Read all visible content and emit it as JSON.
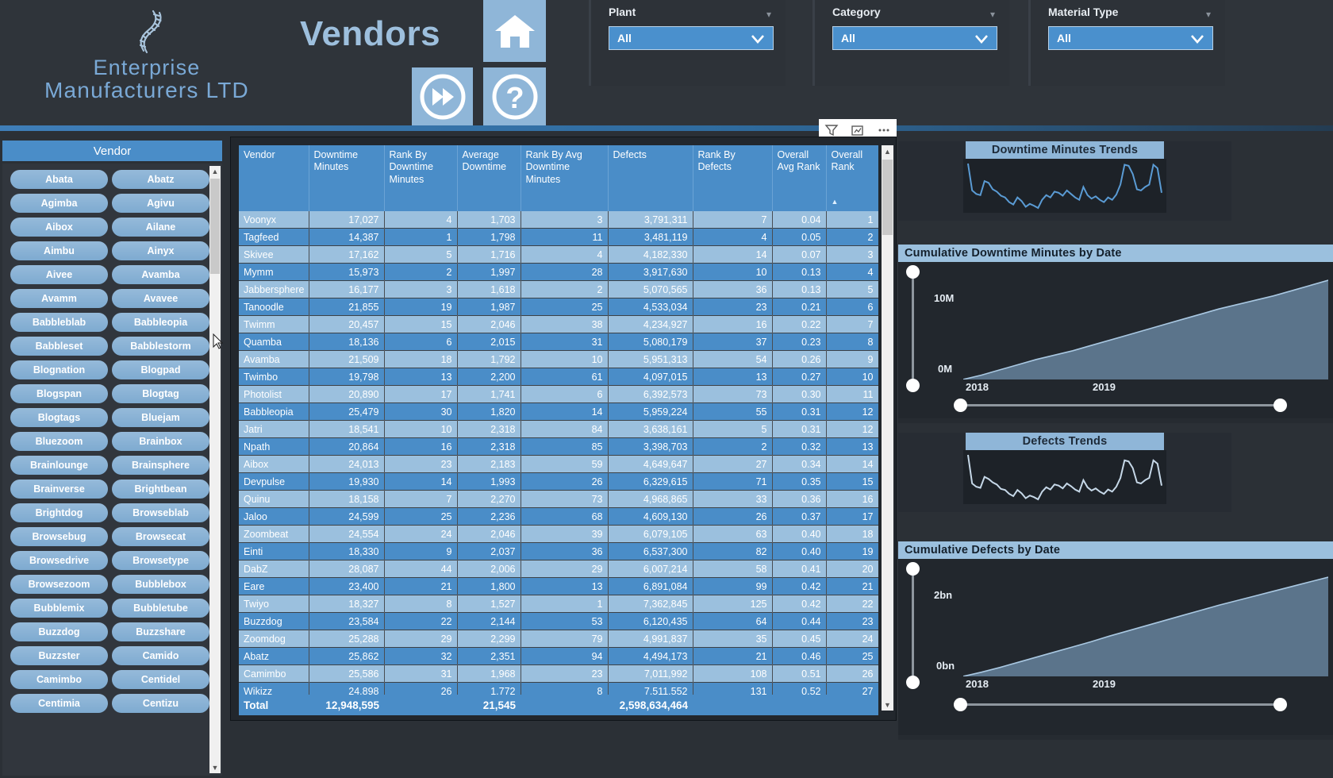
{
  "header": {
    "company_line1": "Enterprise",
    "company_line2": "Manufacturers LTD",
    "page_title": "Vendors",
    "nav": {
      "home": "home-icon",
      "next": "fast-forward-icon",
      "help": "question-mark-icon"
    }
  },
  "slicers": [
    {
      "label": "Plant",
      "value": "All"
    },
    {
      "label": "Category",
      "value": "All"
    },
    {
      "label": "Material Type",
      "value": "All"
    }
  ],
  "vendor_slicer": {
    "title": "Vendor",
    "items": [
      "Abata",
      "Abatz",
      "Agimba",
      "Agivu",
      "Aibox",
      "Ailane",
      "Aimbu",
      "Ainyx",
      "Aivee",
      "Avamba",
      "Avamm",
      "Avavee",
      "Babbleblab",
      "Babbleopia",
      "Babbleset",
      "Babblestorm",
      "Blognation",
      "Blogpad",
      "Blogspan",
      "Blogtag",
      "Blogtags",
      "Bluejam",
      "Bluezoom",
      "Brainbox",
      "Brainlounge",
      "Brainsphere",
      "Brainverse",
      "Brightbean",
      "Brightdog",
      "Browseblab",
      "Browsebug",
      "Browsecat",
      "Browsedrive",
      "Browsetype",
      "Browsezoom",
      "Bubblebox",
      "Bubblemix",
      "Bubbletube",
      "Buzzdog",
      "Buzzshare",
      "Buzzster",
      "Camido",
      "Camimbo",
      "Centidel",
      "Centimia",
      "Centizu"
    ]
  },
  "visual_toolbar": {
    "filter": "filter-icon",
    "focus": "focus-mode-icon",
    "more": "more-options-icon"
  },
  "table": {
    "columns": [
      "Vendor",
      "Downtime Minutes",
      "Rank By Downtime Minutes",
      "Average Downtime",
      "Rank By Avg Downtime Minutes",
      "Defects",
      "Rank By Defects",
      "Overall Avg Rank",
      "Overall Rank"
    ],
    "sorted_column": "Overall Rank",
    "sort_direction": "asc",
    "rows": [
      [
        "Voonyx",
        "17,027",
        "4",
        "1,703",
        "3",
        "3,791,311",
        "7",
        "0.04",
        "1"
      ],
      [
        "Tagfeed",
        "14,387",
        "1",
        "1,798",
        "11",
        "3,481,119",
        "4",
        "0.05",
        "2"
      ],
      [
        "Skivee",
        "17,162",
        "5",
        "1,716",
        "4",
        "4,182,330",
        "14",
        "0.07",
        "3"
      ],
      [
        "Mymm",
        "15,973",
        "2",
        "1,997",
        "28",
        "3,917,630",
        "10",
        "0.13",
        "4"
      ],
      [
        "Jabbersphere",
        "16,177",
        "3",
        "1,618",
        "2",
        "5,070,565",
        "36",
        "0.13",
        "5"
      ],
      [
        "Tanoodle",
        "21,855",
        "19",
        "1,987",
        "25",
        "4,533,034",
        "23",
        "0.21",
        "6"
      ],
      [
        "Twimm",
        "20,457",
        "15",
        "2,046",
        "38",
        "4,234,927",
        "16",
        "0.22",
        "7"
      ],
      [
        "Quamba",
        "18,136",
        "6",
        "2,015",
        "31",
        "5,080,179",
        "37",
        "0.23",
        "8"
      ],
      [
        "Avamba",
        "21,509",
        "18",
        "1,792",
        "10",
        "5,951,313",
        "54",
        "0.26",
        "9"
      ],
      [
        "Twimbo",
        "19,798",
        "13",
        "2,200",
        "61",
        "4,097,015",
        "13",
        "0.27",
        "10"
      ],
      [
        "Photolist",
        "20,890",
        "17",
        "1,741",
        "6",
        "6,392,573",
        "73",
        "0.30",
        "11"
      ],
      [
        "Babbleopia",
        "25,479",
        "30",
        "1,820",
        "14",
        "5,959,224",
        "55",
        "0.31",
        "12"
      ],
      [
        "Jatri",
        "18,541",
        "10",
        "2,318",
        "84",
        "3,638,161",
        "5",
        "0.31",
        "12"
      ],
      [
        "Npath",
        "20,864",
        "16",
        "2,318",
        "85",
        "3,398,703",
        "2",
        "0.32",
        "13"
      ],
      [
        "Aibox",
        "24,013",
        "23",
        "2,183",
        "59",
        "4,649,647",
        "27",
        "0.34",
        "14"
      ],
      [
        "Devpulse",
        "19,930",
        "14",
        "1,993",
        "26",
        "6,329,615",
        "71",
        "0.35",
        "15"
      ],
      [
        "Quinu",
        "18,158",
        "7",
        "2,270",
        "73",
        "4,968,865",
        "33",
        "0.36",
        "16"
      ],
      [
        "Jaloo",
        "24,599",
        "25",
        "2,236",
        "68",
        "4,609,130",
        "26",
        "0.37",
        "17"
      ],
      [
        "Zoombeat",
        "24,554",
        "24",
        "2,046",
        "39",
        "6,079,105",
        "63",
        "0.40",
        "18"
      ],
      [
        "Einti",
        "18,330",
        "9",
        "2,037",
        "36",
        "6,537,300",
        "82",
        "0.40",
        "19"
      ],
      [
        "DabZ",
        "28,087",
        "44",
        "2,006",
        "29",
        "6,007,214",
        "58",
        "0.41",
        "20"
      ],
      [
        "Eare",
        "23,400",
        "21",
        "1,800",
        "13",
        "6,891,084",
        "99",
        "0.42",
        "21"
      ],
      [
        "Twiyo",
        "18,327",
        "8",
        "1,527",
        "1",
        "7,362,845",
        "125",
        "0.42",
        "22"
      ],
      [
        "Buzzdog",
        "23,584",
        "22",
        "2,144",
        "53",
        "6,120,435",
        "64",
        "0.44",
        "23"
      ],
      [
        "Zoomdog",
        "25,288",
        "29",
        "2,299",
        "79",
        "4,991,837",
        "35",
        "0.45",
        "24"
      ],
      [
        "Abatz",
        "25,862",
        "32",
        "2,351",
        "94",
        "4,494,173",
        "21",
        "0.46",
        "25"
      ],
      [
        "Camimbo",
        "25,586",
        "31",
        "1,968",
        "23",
        "7,011,992",
        "108",
        "0.51",
        "26"
      ],
      [
        "Wikizz",
        "24,898",
        "26",
        "1,772",
        "8",
        "7,511,552",
        "131",
        "0.52",
        "27"
      ]
    ],
    "total": {
      "label": "Total",
      "downtime_minutes": "12,948,595",
      "rank_by_downtime_minutes": "",
      "average_downtime": "21,545",
      "rank_by_avg_downtime_minutes": "",
      "defects": "2,598,634,464",
      "rank_by_defects": "",
      "overall_avg_rank": "",
      "overall_rank": ""
    }
  },
  "chart_data": [
    {
      "type": "line",
      "title": "Downtime Minutes Trends",
      "xlabel": "",
      "ylabel": "",
      "grid": false,
      "legend": false,
      "values": [
        88,
        42,
        36,
        34,
        58,
        55,
        44,
        40,
        33,
        30,
        22,
        18,
        30,
        24,
        14,
        19,
        16,
        12,
        26,
        34,
        30,
        40,
        38,
        33,
        42,
        36,
        30,
        26,
        48,
        34,
        28,
        32,
        26,
        22,
        30,
        26,
        35,
        52,
        86,
        84,
        70,
        44,
        42,
        48,
        52,
        86,
        80,
        38
      ]
    },
    {
      "type": "area",
      "title": "Cumulative Downtime Minutes by Date",
      "xlabel": "",
      "ylabel": "",
      "ytick_labels": [
        "0M",
        "10M"
      ],
      "xtick_labels": [
        "2018",
        "2019"
      ],
      "ylim": [
        0,
        13000000
      ],
      "grid": false,
      "legend": false,
      "x": [
        0,
        5,
        10,
        15,
        20,
        25,
        30,
        35,
        40,
        45,
        50,
        55,
        60,
        65,
        70,
        75,
        80,
        85,
        90,
        95,
        100
      ],
      "values": [
        0,
        0.5,
        1.1,
        1.7,
        2.3,
        2.8,
        3.3,
        3.9,
        4.5,
        5.1,
        5.7,
        6.3,
        6.9,
        7.5,
        8.1,
        8.6,
        9.1,
        9.6,
        10.2,
        10.8,
        11.4
      ]
    },
    {
      "type": "line",
      "title": "Defects Trends",
      "xlabel": "",
      "ylabel": "",
      "grid": false,
      "legend": false,
      "values": [
        92,
        40,
        34,
        32,
        52,
        48,
        42,
        38,
        30,
        28,
        21,
        17,
        28,
        22,
        13,
        18,
        15,
        11,
        25,
        33,
        29,
        38,
        36,
        31,
        40,
        35,
        29,
        25,
        46,
        33,
        27,
        31,
        25,
        21,
        29,
        25,
        34,
        50,
        82,
        80,
        68,
        42,
        40,
        46,
        50,
        82,
        76,
        36
      ]
    },
    {
      "type": "area",
      "title": "Cumulative Defects by Date",
      "xlabel": "",
      "ylabel": "",
      "ytick_labels": [
        "0bn",
        "2bn"
      ],
      "xtick_labels": [
        "2018",
        "2019"
      ],
      "ylim": [
        0,
        2600000000
      ],
      "grid": false,
      "legend": false,
      "x": [
        0,
        5,
        10,
        15,
        20,
        25,
        30,
        35,
        40,
        45,
        50,
        55,
        60,
        65,
        70,
        75,
        80,
        85,
        90,
        95,
        100
      ],
      "values": [
        0,
        0.09,
        0.19,
        0.3,
        0.41,
        0.52,
        0.63,
        0.74,
        0.86,
        0.97,
        1.08,
        1.19,
        1.3,
        1.41,
        1.52,
        1.62,
        1.72,
        1.82,
        1.92,
        2.02,
        2.12
      ]
    }
  ]
}
